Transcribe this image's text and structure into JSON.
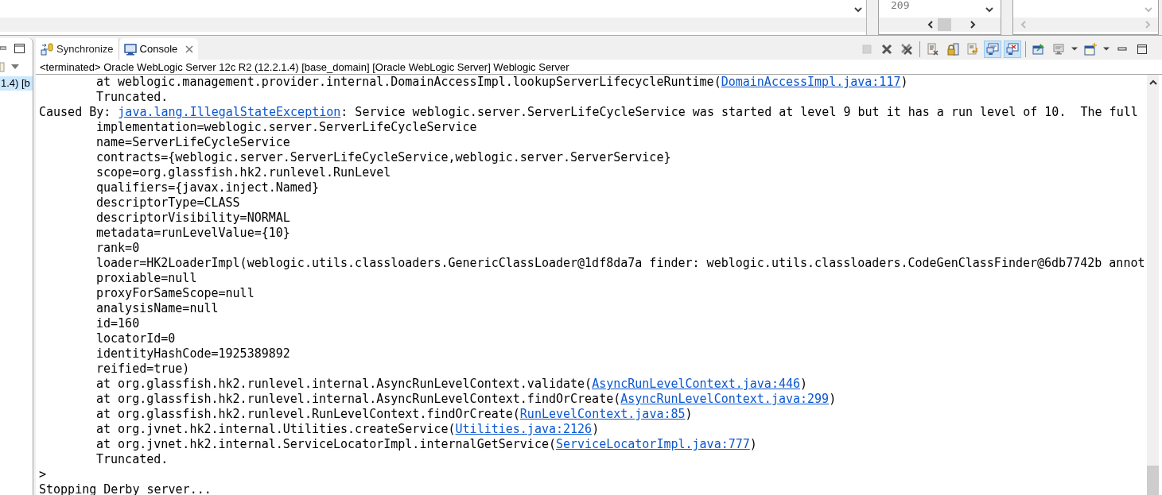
{
  "top_panes": {
    "line_numbers": [
      "209"
    ]
  },
  "side_panel": {
    "item": {
      "label": "1.4) [b",
      "selected": true
    }
  },
  "tabs": [
    {
      "label": "Synchronize",
      "kind": "sync",
      "selected": false,
      "closable": false
    },
    {
      "label": "Console",
      "kind": "console",
      "selected": true,
      "closable": true
    }
  ],
  "toolbar_groups": [
    [
      {
        "kind": "stop",
        "disabled": true
      },
      {
        "kind": "remove",
        "disabled": false
      },
      {
        "kind": "remove_all",
        "disabled": false
      }
    ],
    [
      {
        "kind": "clear",
        "selected": false
      },
      {
        "kind": "lock",
        "selected": false
      },
      {
        "kind": "wrap",
        "selected": false
      },
      {
        "kind": "stdout",
        "selected": true
      },
      {
        "kind": "stderr",
        "selected": true
      }
    ],
    [
      {
        "kind": "pin"
      },
      {
        "kind": "display"
      },
      {
        "kind": "dropdown"
      },
      {
        "kind": "new"
      },
      {
        "kind": "dropdown"
      },
      {
        "kind": "minimize"
      },
      {
        "kind": "maximize"
      }
    ]
  ],
  "console": {
    "description": "<terminated> Oracle WebLogic Server 12c R2 (12.2.1.4) [base_domain] [Oracle WebLogic Server] Weblogic Server",
    "lines": [
      {
        "kind": "indented",
        "segments": [
          {
            "kind": "text",
            "text": "at weblogic.management.provider.internal.DomainAccessImpl.lookupServerLifecycleRuntime("
          },
          {
            "kind": "link",
            "text": "DomainAccessImpl.java:117"
          },
          {
            "kind": "text",
            "text": ")"
          }
        ]
      },
      {
        "kind": "indented",
        "segments": [
          {
            "kind": "text",
            "text": "Truncated."
          }
        ]
      },
      {
        "kind": "plain",
        "segments": [
          {
            "kind": "text",
            "text": "Caused By: "
          },
          {
            "kind": "link",
            "text": "java.lang.IllegalStateException"
          },
          {
            "kind": "text",
            "text": ": Service weblogic.server.ServerLifeCycleService was started at level 9 but it has a run level of 10.  The full"
          }
        ]
      },
      {
        "kind": "indented",
        "segments": [
          {
            "kind": "text",
            "text": "implementation=weblogic.server.ServerLifeCycleService"
          }
        ]
      },
      {
        "kind": "indented",
        "segments": [
          {
            "kind": "text",
            "text": "name=ServerLifeCycleService"
          }
        ]
      },
      {
        "kind": "indented",
        "segments": [
          {
            "kind": "text",
            "text": "contracts={weblogic.server.ServerLifeCycleService,weblogic.server.ServerService}"
          }
        ]
      },
      {
        "kind": "indented",
        "segments": [
          {
            "kind": "text",
            "text": "scope=org.glassfish.hk2.runlevel.RunLevel"
          }
        ]
      },
      {
        "kind": "indented",
        "segments": [
          {
            "kind": "text",
            "text": "qualifiers={javax.inject.Named}"
          }
        ]
      },
      {
        "kind": "indented",
        "segments": [
          {
            "kind": "text",
            "text": "descriptorType=CLASS"
          }
        ]
      },
      {
        "kind": "indented",
        "segments": [
          {
            "kind": "text",
            "text": "descriptorVisibility=NORMAL"
          }
        ]
      },
      {
        "kind": "indented",
        "segments": [
          {
            "kind": "text",
            "text": "metadata=runLevelValue={10}"
          }
        ]
      },
      {
        "kind": "indented",
        "segments": [
          {
            "kind": "text",
            "text": "rank=0"
          }
        ]
      },
      {
        "kind": "indented",
        "segments": [
          {
            "kind": "text",
            "text": "loader=HK2LoaderImpl(weblogic.utils.classloaders.GenericClassLoader@1df8da7a finder: weblogic.utils.classloaders.CodeGenClassFinder@6db7742b annot"
          }
        ]
      },
      {
        "kind": "indented",
        "segments": [
          {
            "kind": "text",
            "text": "proxiable=null"
          }
        ]
      },
      {
        "kind": "indented",
        "segments": [
          {
            "kind": "text",
            "text": "proxyForSameScope=null"
          }
        ]
      },
      {
        "kind": "indented",
        "segments": [
          {
            "kind": "text",
            "text": "analysisName=null"
          }
        ]
      },
      {
        "kind": "indented",
        "segments": [
          {
            "kind": "text",
            "text": "id=160"
          }
        ]
      },
      {
        "kind": "indented",
        "segments": [
          {
            "kind": "text",
            "text": "locatorId=0"
          }
        ]
      },
      {
        "kind": "indented",
        "segments": [
          {
            "kind": "text",
            "text": "identityHashCode=1925389892"
          }
        ]
      },
      {
        "kind": "indented",
        "segments": [
          {
            "kind": "text",
            "text": "reified=true)"
          }
        ]
      },
      {
        "kind": "indented",
        "segments": [
          {
            "kind": "text",
            "text": "at org.glassfish.hk2.runlevel.internal.AsyncRunLevelContext.validate("
          },
          {
            "kind": "link",
            "text": "AsyncRunLevelContext.java:446"
          },
          {
            "kind": "text",
            "text": ")"
          }
        ]
      },
      {
        "kind": "indented",
        "segments": [
          {
            "kind": "text",
            "text": "at org.glassfish.hk2.runlevel.internal.AsyncRunLevelContext.findOrCreate("
          },
          {
            "kind": "link",
            "text": "AsyncRunLevelContext.java:299"
          },
          {
            "kind": "text",
            "text": ")"
          }
        ]
      },
      {
        "kind": "indented",
        "segments": [
          {
            "kind": "text",
            "text": "at org.glassfish.hk2.runlevel.RunLevelContext.findOrCreate("
          },
          {
            "kind": "link",
            "text": "RunLevelContext.java:85"
          },
          {
            "kind": "text",
            "text": ")"
          }
        ]
      },
      {
        "kind": "indented",
        "segments": [
          {
            "kind": "text",
            "text": "at org.jvnet.hk2.internal.Utilities.createService("
          },
          {
            "kind": "link",
            "text": "Utilities.java:2126"
          },
          {
            "kind": "text",
            "text": ")"
          }
        ]
      },
      {
        "kind": "indented",
        "segments": [
          {
            "kind": "text",
            "text": "at org.jvnet.hk2.internal.ServiceLocatorImpl.internalGetService("
          },
          {
            "kind": "link",
            "text": "ServiceLocatorImpl.java:777"
          },
          {
            "kind": "text",
            "text": ")"
          }
        ]
      },
      {
        "kind": "indented",
        "segments": [
          {
            "kind": "text",
            "text": "Truncated."
          }
        ]
      },
      {
        "kind": "plain",
        "segments": [
          {
            "kind": "text",
            "text": ">"
          }
        ]
      },
      {
        "kind": "plain",
        "segments": [
          {
            "kind": "text",
            "text": "Stopping Derby server..."
          }
        ]
      }
    ]
  }
}
